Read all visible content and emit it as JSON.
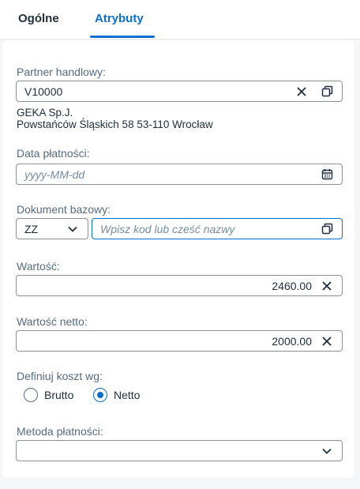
{
  "tabs": [
    {
      "label": "Ogólne",
      "active": false
    },
    {
      "label": "Atrybuty",
      "active": true
    }
  ],
  "partner": {
    "label": "Partner handlowy:",
    "value": "V10000",
    "name": "GEKA Sp.J.",
    "address": "Powstańców Śląskich 58 53-110 Wrocław"
  },
  "payment_date": {
    "label": "Data płatności:",
    "placeholder": "yyyy-MM-dd"
  },
  "base_document": {
    "label": "Dokument bazowy:",
    "type_value": "ZZ",
    "placeholder": "Wpisz kod lub cześć nazwy"
  },
  "value": {
    "label": "Wartość:",
    "amount": "2460.00"
  },
  "net_value": {
    "label": "Wartość netto:",
    "amount": "2000.00"
  },
  "cost_basis": {
    "label": "Definiuj koszt wg:",
    "options": [
      {
        "label": "Brutto",
        "selected": false
      },
      {
        "label": "Netto",
        "selected": true
      }
    ]
  },
  "payment_method": {
    "label": "Metoda płatności:",
    "value": ""
  },
  "colors": {
    "accent": "#0a6ed1",
    "text": "#1d2d3e",
    "label": "#556b82"
  }
}
